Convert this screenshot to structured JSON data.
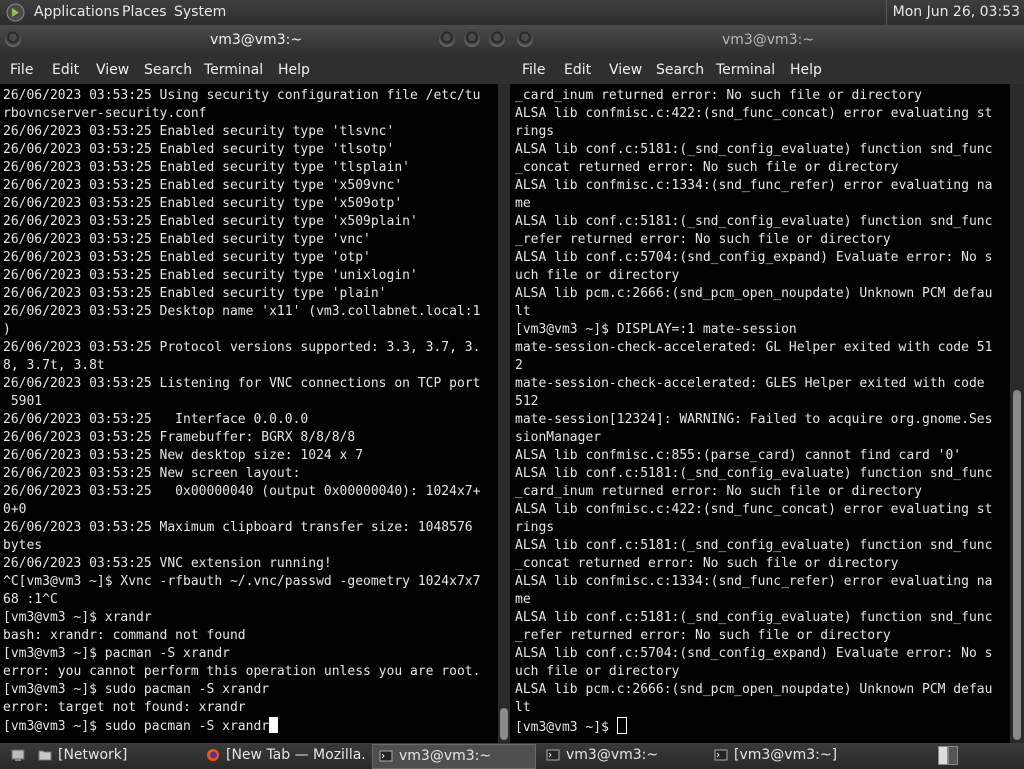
{
  "top_panel": {
    "menus": [
      "Applications",
      "Places",
      "System"
    ],
    "clock": "Mon Jun 26, 03:53"
  },
  "left_window": {
    "title": "vm3@vm3:~",
    "menu": [
      "File",
      "Edit",
      "View",
      "Search",
      "Terminal",
      "Help"
    ],
    "lines": [
      "26/06/2023 03:53:25 Using security configuration file /etc/tu",
      "rbovncserver-security.conf",
      "26/06/2023 03:53:25 Enabled security type 'tlsvnc'",
      "26/06/2023 03:53:25 Enabled security type 'tlsotp'",
      "26/06/2023 03:53:25 Enabled security type 'tlsplain'",
      "26/06/2023 03:53:25 Enabled security type 'x509vnc'",
      "26/06/2023 03:53:25 Enabled security type 'x509otp'",
      "26/06/2023 03:53:25 Enabled security type 'x509plain'",
      "26/06/2023 03:53:25 Enabled security type 'vnc'",
      "26/06/2023 03:53:25 Enabled security type 'otp'",
      "26/06/2023 03:53:25 Enabled security type 'unixlogin'",
      "26/06/2023 03:53:25 Enabled security type 'plain'",
      "26/06/2023 03:53:25 Desktop name 'x11' (vm3.collabnet.local:1",
      ")",
      "26/06/2023 03:53:25 Protocol versions supported: 3.3, 3.7, 3.",
      "8, 3.7t, 3.8t",
      "26/06/2023 03:53:25 Listening for VNC connections on TCP port",
      " 5901",
      "26/06/2023 03:53:25   Interface 0.0.0.0",
      "26/06/2023 03:53:25 Framebuffer: BGRX 8/8/8/8",
      "26/06/2023 03:53:25 New desktop size: 1024 x 7",
      "26/06/2023 03:53:25 New screen layout:",
      "26/06/2023 03:53:25   0x00000040 (output 0x00000040): 1024x7+",
      "0+0",
      "26/06/2023 03:53:25 Maximum clipboard transfer size: 1048576",
      "bytes",
      "26/06/2023 03:53:25 VNC extension running!",
      "^C[vm3@vm3 ~]$ Xvnc -rfbauth ~/.vnc/passwd -geometry 1024x7x7",
      "68 :1^C",
      "[vm3@vm3 ~]$ xrandr",
      "bash: xrandr: command not found",
      "[vm3@vm3 ~]$ pacman -S xrandr",
      "error: you cannot perform this operation unless you are root.",
      "[vm3@vm3 ~]$ sudo pacman -S xrandr",
      "error: target not found: xrandr",
      "[vm3@vm3 ~]$ sudo pacman -S xrandr"
    ]
  },
  "right_window": {
    "title": "vm3@vm3:~",
    "menu": [
      "File",
      "Edit",
      "View",
      "Search",
      "Terminal",
      "Help"
    ],
    "lines": [
      "_card_inum returned error: No such file or directory",
      "ALSA lib confmisc.c:422:(snd_func_concat) error evaluating st",
      "rings",
      "ALSA lib conf.c:5181:(_snd_config_evaluate) function snd_func",
      "_concat returned error: No such file or directory",
      "ALSA lib confmisc.c:1334:(snd_func_refer) error evaluating na",
      "me",
      "ALSA lib conf.c:5181:(_snd_config_evaluate) function snd_func",
      "_refer returned error: No such file or directory",
      "ALSA lib conf.c:5704:(snd_config_expand) Evaluate error: No s",
      "uch file or directory",
      "ALSA lib pcm.c:2666:(snd_pcm_open_noupdate) Unknown PCM defau",
      "lt",
      "[vm3@vm3 ~]$ DISPLAY=:1 mate-session",
      "mate-session-check-accelerated: GL Helper exited with code 51",
      "2",
      "mate-session-check-accelerated: GLES Helper exited with code",
      "512",
      "mate-session[12324]: WARNING: Failed to acquire org.gnome.Ses",
      "sionManager",
      "ALSA lib confmisc.c:855:(parse_card) cannot find card '0'",
      "ALSA lib conf.c:5181:(_snd_config_evaluate) function snd_func",
      "_card_inum returned error: No such file or directory",
      "ALSA lib confmisc.c:422:(snd_func_concat) error evaluating st",
      "rings",
      "ALSA lib conf.c:5181:(_snd_config_evaluate) function snd_func",
      "_concat returned error: No such file or directory",
      "ALSA lib confmisc.c:1334:(snd_func_refer) error evaluating na",
      "me",
      "ALSA lib conf.c:5181:(_snd_config_evaluate) function snd_func",
      "_refer returned error: No such file or directory",
      "ALSA lib conf.c:5704:(snd_config_expand) Evaluate error: No s",
      "uch file or directory",
      "ALSA lib pcm.c:2666:(snd_pcm_open_noupdate) Unknown PCM defau",
      "lt",
      "[vm3@vm3 ~]$ "
    ]
  },
  "taskbar": {
    "items": [
      {
        "label": "[Network]",
        "icon": "folder-icon"
      },
      {
        "label": "[New Tab — Mozilla...",
        "icon": "firefox-icon"
      },
      {
        "label": "vm3@vm3:~",
        "icon": "terminal-icon"
      },
      {
        "label": "vm3@vm3:~",
        "icon": "terminal-icon"
      },
      {
        "label": "[vm3@vm3:~]",
        "icon": "terminal-icon"
      }
    ]
  }
}
